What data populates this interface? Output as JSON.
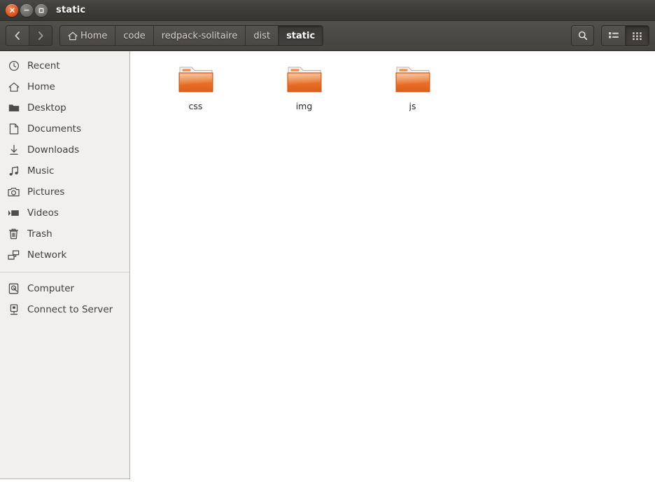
{
  "window": {
    "title": "static",
    "controls": [
      {
        "name": "close",
        "label": "Close"
      },
      {
        "name": "minimize",
        "label": "Minimize"
      },
      {
        "name": "maximize",
        "label": "Maximize"
      }
    ]
  },
  "toolbar": {
    "back_label": "Back",
    "forward_label": "Forward",
    "search_label": "Search",
    "list_view_label": "List view",
    "grid_view_label": "Icon view",
    "active_view": "grid",
    "breadcrumb": [
      {
        "label": "Home",
        "icon": "home-icon",
        "active": false
      },
      {
        "label": "code",
        "icon": "",
        "active": false
      },
      {
        "label": "redpack-solitaire",
        "icon": "",
        "active": false
      },
      {
        "label": "dist",
        "icon": "",
        "active": false
      },
      {
        "label": "static",
        "icon": "",
        "active": true
      }
    ]
  },
  "sidebar": {
    "groups": [
      {
        "items": [
          {
            "label": "Recent",
            "icon": "clock-icon"
          },
          {
            "label": "Home",
            "icon": "home-icon"
          },
          {
            "label": "Desktop",
            "icon": "folder-icon"
          },
          {
            "label": "Documents",
            "icon": "document-icon"
          },
          {
            "label": "Downloads",
            "icon": "download-icon"
          },
          {
            "label": "Music",
            "icon": "music-note-icon"
          },
          {
            "label": "Pictures",
            "icon": "camera-icon"
          },
          {
            "label": "Videos",
            "icon": "video-icon"
          },
          {
            "label": "Trash",
            "icon": "trash-icon"
          },
          {
            "label": "Network",
            "icon": "network-icon"
          }
        ]
      },
      {
        "items": [
          {
            "label": "Computer",
            "icon": "computer-icon"
          },
          {
            "label": "Connect to Server",
            "icon": "server-icon"
          }
        ]
      }
    ]
  },
  "content": {
    "files": [
      {
        "name": "css",
        "type": "folder"
      },
      {
        "name": "img",
        "type": "folder"
      },
      {
        "name": "js",
        "type": "folder"
      }
    ]
  },
  "colors": {
    "titlebar": "#3d3b38",
    "toolbar": "#4b4945",
    "sidebar_bg": "#f1f0ee",
    "content_bg": "#ffffff",
    "folder_orange": "#e8622a",
    "close_button": "#e0561f",
    "text_light": "#d6d3cd",
    "text_dark": "#40403f"
  }
}
